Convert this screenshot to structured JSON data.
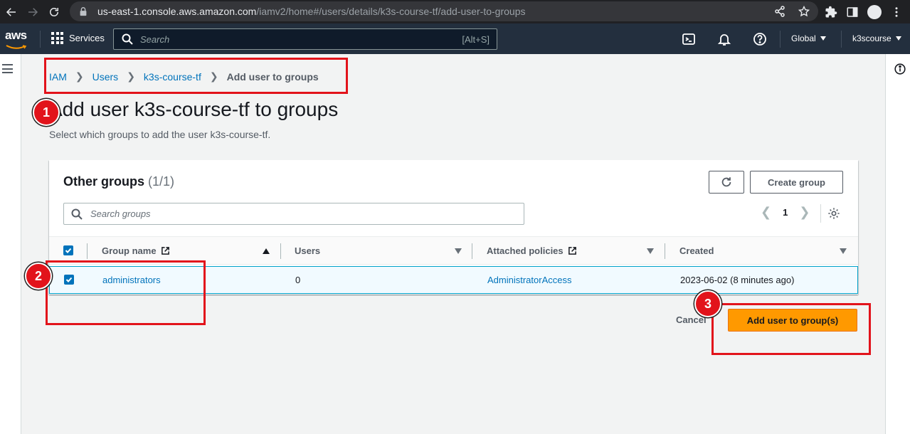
{
  "browser": {
    "url_host": "us-east-1.console.aws.amazon.com",
    "url_path": "/iamv2/home#/users/details/k3s-course-tf/add-user-to-groups"
  },
  "topnav": {
    "logo": "aws",
    "services_label": "Services",
    "search_placeholder": "Search",
    "search_shortcut": "[Alt+S]",
    "region": "Global",
    "account": "k3scourse"
  },
  "breadcrumb": {
    "items": [
      "IAM",
      "Users",
      "k3s-course-tf"
    ],
    "current": "Add user to groups"
  },
  "page": {
    "title": "Add user k3s-course-tf to groups",
    "description": "Select which groups to add the user k3s-course-tf."
  },
  "groups_panel": {
    "title": "Other groups",
    "count": "(1/1)",
    "create_button": "Create group",
    "search_placeholder": "Search groups",
    "page_number": "1",
    "columns": [
      "Group name",
      "Users",
      "Attached policies",
      "Created"
    ],
    "rows": [
      {
        "selected": true,
        "group_name": "administrators",
        "users": "0",
        "attached_policies": "AdministratorAccess",
        "created": "2023-06-02 (8 minutes ago)"
      }
    ]
  },
  "actions": {
    "cancel": "Cancel",
    "primary": "Add user to group(s)"
  },
  "annotations": [
    "1",
    "2",
    "3"
  ],
  "colors": {
    "aws_nav": "#232f3e",
    "link": "#0073bb",
    "primary": "#ff9900",
    "annotation_red": "#e2131b"
  }
}
